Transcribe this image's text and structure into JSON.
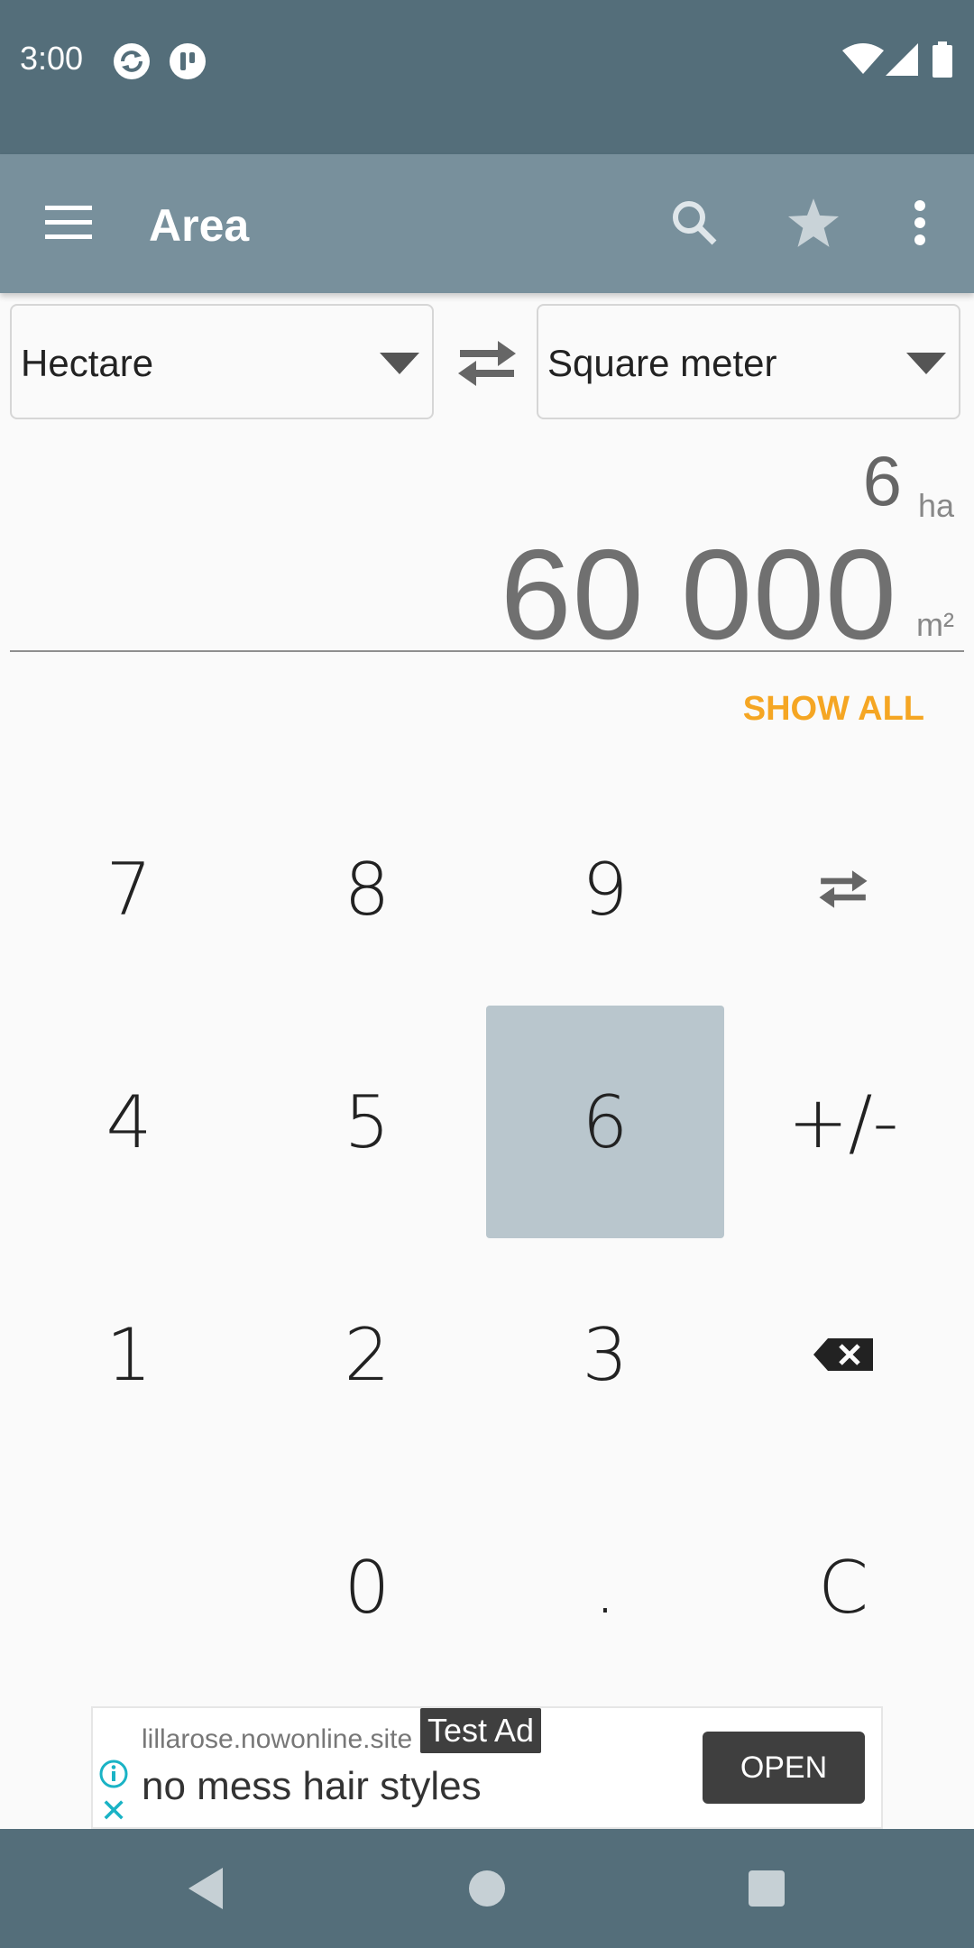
{
  "status_bar": {
    "time": "3:00"
  },
  "toolbar": {
    "title": "Area"
  },
  "converter": {
    "from_unit": "Hectare",
    "to_unit": "Square meter",
    "input_value": "6",
    "input_symbol": "ha",
    "output_value": "60 000",
    "output_symbol": "m²",
    "show_all_label": "SHOW ALL"
  },
  "keypad": {
    "k7": "7",
    "k8": "8",
    "k9": "9",
    "k4": "4",
    "k5": "5",
    "k6": "6",
    "sign": "+/-",
    "k1": "1",
    "k2": "2",
    "k3": "3",
    "k0": "0",
    "dot": ".",
    "clear": "C",
    "pressed_key": "6"
  },
  "ad": {
    "host": "lillarose.nowonline.site",
    "badge": "Test Ad",
    "headline": "no mess hair styles",
    "open_label": "OPEN"
  },
  "colors": {
    "status_bar": "#546e7a",
    "toolbar": "#78909c",
    "accent": "#f5a623",
    "pressed_key": "#b9c6cd"
  }
}
